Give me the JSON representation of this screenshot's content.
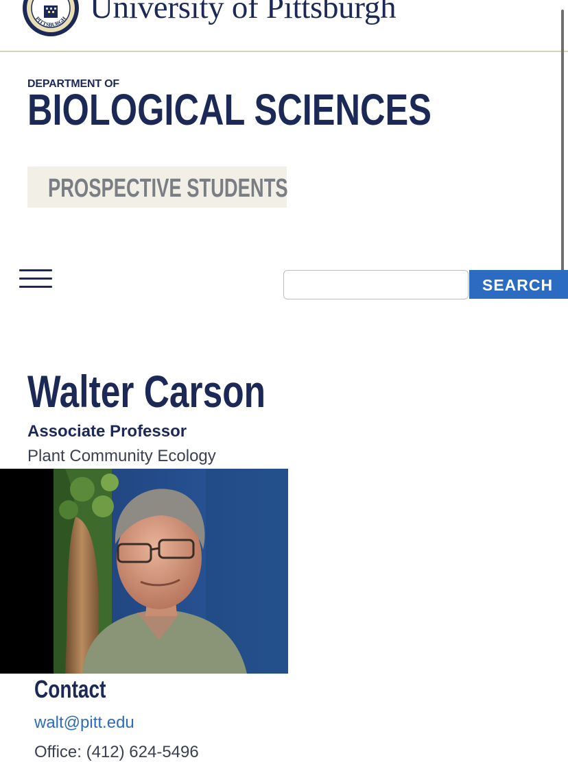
{
  "header": {
    "university_name": "University of Pittsburgh",
    "seal_text": "PITTSBURGH"
  },
  "department": {
    "prefix": "DEPARTMENT OF",
    "name": "BIOLOGICAL SCIENCES"
  },
  "nav": {
    "prospective_label": "PROSPECTIVE STUDENTS",
    "menu_icon": "hamburger-icon"
  },
  "search": {
    "placeholder": "",
    "value": "",
    "button_label": "SEARCH"
  },
  "profile": {
    "name": "Walter Carson",
    "title": "Associate Professor",
    "field": "Plant Community Ecology"
  },
  "contact": {
    "heading": "Contact",
    "email": "walt@pitt.edu",
    "office": "Office: (412) 624-5496"
  },
  "colors": {
    "navy": "#1c2957",
    "search_blue": "#2c6bc2",
    "prospective_bg": "#f1efe6",
    "gold_rule": "#d8d2b8"
  }
}
